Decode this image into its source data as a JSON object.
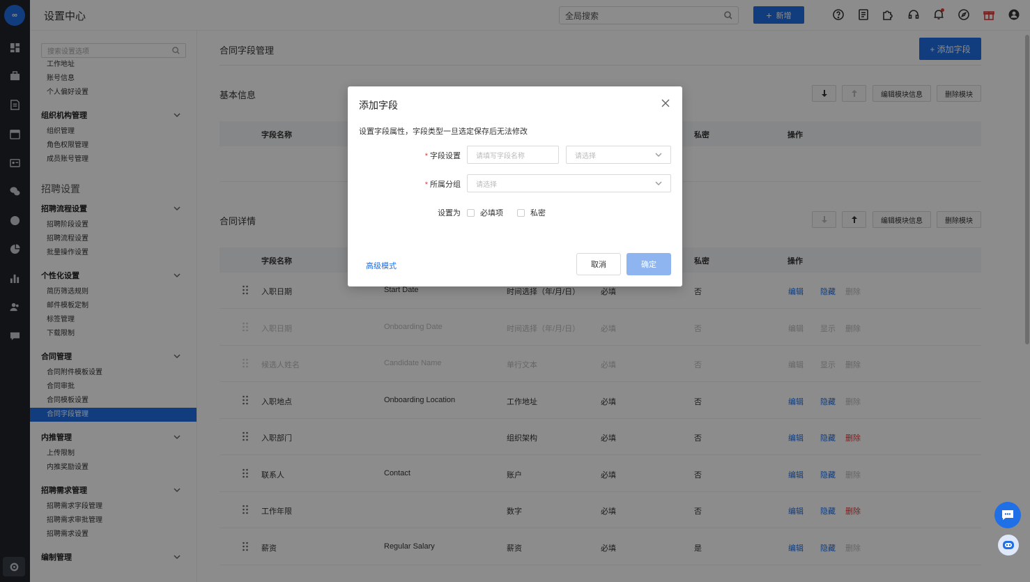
{
  "app": {
    "title": "设置中心",
    "logo_text": "∞"
  },
  "topbar": {
    "search_placeholder": "全局搜索",
    "new_button": "新增",
    "icons": [
      "help-icon",
      "document-icon",
      "puzzle-icon",
      "headset-icon",
      "bell-icon",
      "compass-icon",
      "gift-icon",
      "user-icon"
    ]
  },
  "rail_icons": [
    "dashboard-icon",
    "briefcase-icon",
    "resume-icon",
    "calendar-icon",
    "contact-card-icon",
    "wechat-icon",
    "pie-icon",
    "analysis-icon",
    "bar-chart-icon",
    "people-icon",
    "chat-icon",
    "settings-icon"
  ],
  "sidebar": {
    "search_placeholder": "搜索设置选项",
    "top_items": [
      "工作地址",
      "账号信息",
      "个人偏好设置"
    ],
    "org_group": "组织机构管理",
    "org_items": [
      "组织管理",
      "角色权限管理",
      "成员账号管理"
    ],
    "section_recruit": "招聘设置",
    "flow_group": "招聘流程设置",
    "flow_items": [
      "招聘阶段设置",
      "招聘流程设置",
      "批量操作设置"
    ],
    "personal_group": "个性化设置",
    "personal_items": [
      "简历筛选规则",
      "邮件模板定制",
      "标签管理",
      "下载限制"
    ],
    "contract_group": "合同管理",
    "contract_items": [
      "合同附件模板设置",
      "合同审批",
      "合同模板设置",
      "合同字段管理"
    ],
    "referral_group": "内推管理",
    "referral_items": [
      "上传限制",
      "内推奖励设置"
    ],
    "demand_group": "招聘需求管理",
    "demand_items": [
      "招聘需求字段管理",
      "招聘需求审批管理",
      "招聘需求设置"
    ],
    "staff_group": "编制管理"
  },
  "main": {
    "page_title": "合同字段管理",
    "add_field_button": "+ 添加字段",
    "sections": [
      {
        "title": "基本信息",
        "edit": "编辑模块信息",
        "remove": "删除模块"
      },
      {
        "title": "合同详情",
        "edit": "编辑模块信息",
        "remove": "删除模块"
      }
    ],
    "columns": {
      "name": "字段名称",
      "private": "私密",
      "action": "操作"
    },
    "rows": [
      {
        "name": "入职日期",
        "en": "Start Date",
        "type": "时间选择（年/月/日）",
        "req": "必填",
        "private": "否",
        "edit": "编辑",
        "toggle": "隐藏",
        "del": "删除",
        "dim": false,
        "del_on": false
      },
      {
        "name": "入职日期",
        "en": "Onboarding Date",
        "type": "时间选择（年/月/日）",
        "req": "必填",
        "private": "否",
        "edit": "编辑",
        "toggle": "显示",
        "del": "删除",
        "dim": true,
        "del_on": false
      },
      {
        "name": "候选人姓名",
        "en": "Candidate Name",
        "type": "单行文本",
        "req": "必填",
        "private": "否",
        "edit": "编辑",
        "toggle": "显示",
        "del": "删除",
        "dim": true,
        "del_on": false
      },
      {
        "name": "入职地点",
        "en": "Onboarding Location",
        "type": "工作地址",
        "req": "必填",
        "private": "否",
        "edit": "编辑",
        "toggle": "隐藏",
        "del": "删除",
        "dim": false,
        "del_on": false
      },
      {
        "name": "入职部门",
        "en": "",
        "type": "组织架构",
        "req": "必填",
        "private": "否",
        "edit": "编辑",
        "toggle": "隐藏",
        "del": "删除",
        "dim": false,
        "del_on": true
      },
      {
        "name": "联系人",
        "en": "Contact",
        "type": "账户",
        "req": "必填",
        "private": "否",
        "edit": "编辑",
        "toggle": "隐藏",
        "del": "删除",
        "dim": false,
        "del_on": false
      },
      {
        "name": "工作年限",
        "en": "",
        "type": "数字",
        "req": "必填",
        "private": "否",
        "edit": "编辑",
        "toggle": "隐藏",
        "del": "删除",
        "dim": false,
        "del_on": true
      },
      {
        "name": "薪资",
        "en": "Regular Salary",
        "type": "薪资",
        "req": "必填",
        "private": "是",
        "edit": "编辑",
        "toggle": "隐藏",
        "del": "删除",
        "dim": false,
        "del_on": false
      }
    ]
  },
  "modal": {
    "title": "添加字段",
    "hint": "设置字段属性，字段类型一旦选定保存后无法修改",
    "field_label": "字段设置",
    "field_name_placeholder": "请填写字段名称",
    "field_type_placeholder": "请选择",
    "group_label": "所属分组",
    "group_placeholder": "请选择",
    "set_as_label": "设置为",
    "required_option": "必填项",
    "private_option": "私密",
    "advanced_link": "高级模式",
    "cancel_button": "取消",
    "confirm_button": "确定"
  },
  "colors": {
    "primary": "#1f6fe6",
    "danger": "#e53935",
    "rail": "#1f2329"
  }
}
